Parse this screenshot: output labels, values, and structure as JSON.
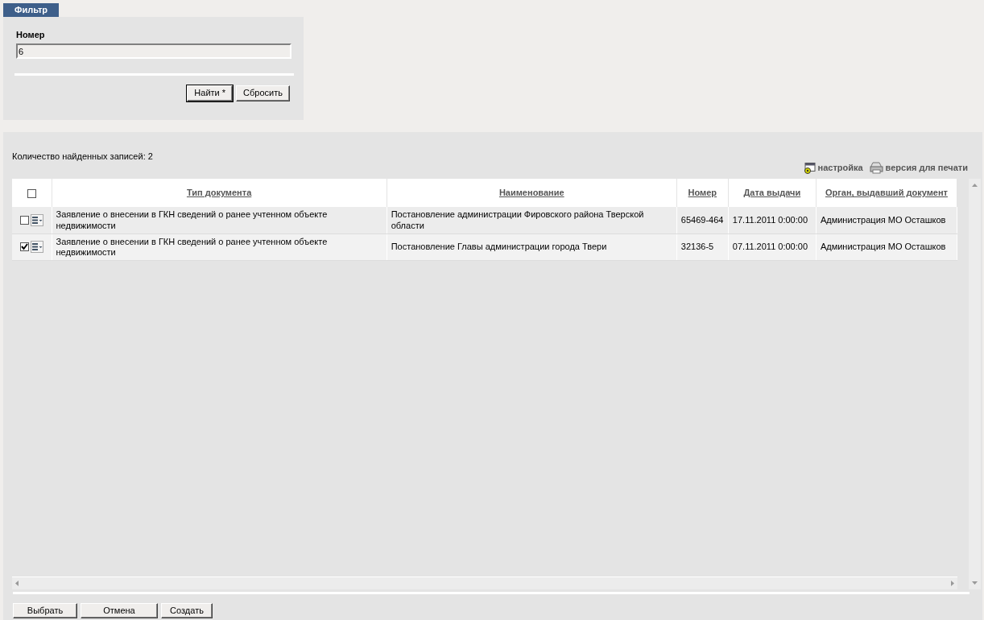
{
  "filter": {
    "tab": "Фильтр",
    "field_label": "Номер",
    "field_value": "6",
    "buttons": [
      {
        "label": "Найти *",
        "default": true
      },
      {
        "label": "Сбросить",
        "default": false
      }
    ]
  },
  "results": {
    "count_text": "Количество найденных записей: 2",
    "toolbar": [
      {
        "kind": "settings",
        "label": "настройка"
      },
      {
        "kind": "print",
        "label": "версия для печати"
      }
    ],
    "table": {
      "select_all_checked": false,
      "columns": [
        "Тип документа",
        "Наименование",
        "Номер",
        "Дата выдачи",
        "Орган, выдавший документ"
      ],
      "rows": [
        {
          "checked": false,
          "cells": [
            "Заявление о внесении в ГКН сведений о ранее учтенном объекте недвижимости",
            "Постановление администрации Фировского района Тверской области",
            "65469-464",
            "17.11.2011 0:00:00",
            "Администрация МО Осташков"
          ]
        },
        {
          "checked": true,
          "cells": [
            "Заявление о внесении в ГКН сведений о ранее учтенном объекте недвижимости",
            "Постановление Главы администрации города Твери",
            "32136-5",
            "07.11.2011 0:00:00",
            "Администрация МО Осташков"
          ]
        }
      ]
    },
    "buttons": [
      "Выбрать",
      "Отмена",
      "Создать"
    ]
  }
}
